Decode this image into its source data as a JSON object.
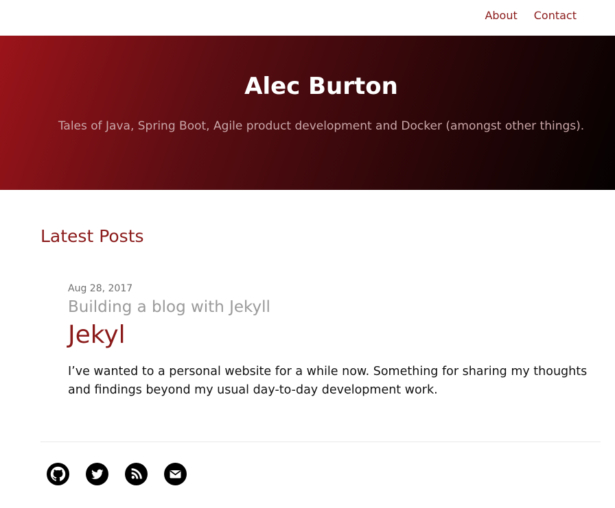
{
  "nav": {
    "items": [
      {
        "label": "About"
      },
      {
        "label": "Contact"
      }
    ]
  },
  "hero": {
    "title": "Alec Burton",
    "tagline": "Tales of Java, Spring Boot, Agile product development and Docker (amongst other things)."
  },
  "main": {
    "section_title": "Latest Posts",
    "posts": [
      {
        "date": "Aug 28, 2017",
        "subtitle": "Building a blog with Jekyll",
        "title": "Jekyl",
        "excerpt": "I’ve wanted to a personal website for a while now. Something for sharing my thoughts and findings beyond my usual day-to-day development work."
      }
    ]
  },
  "footer": {
    "social": [
      {
        "icon": "github-icon"
      },
      {
        "icon": "twitter-icon"
      },
      {
        "icon": "rss-icon"
      },
      {
        "icon": "mail-icon"
      }
    ]
  },
  "colors": {
    "accent": "#8b1a1a",
    "hero_start": "#9b141a",
    "hero_end": "#050101"
  }
}
